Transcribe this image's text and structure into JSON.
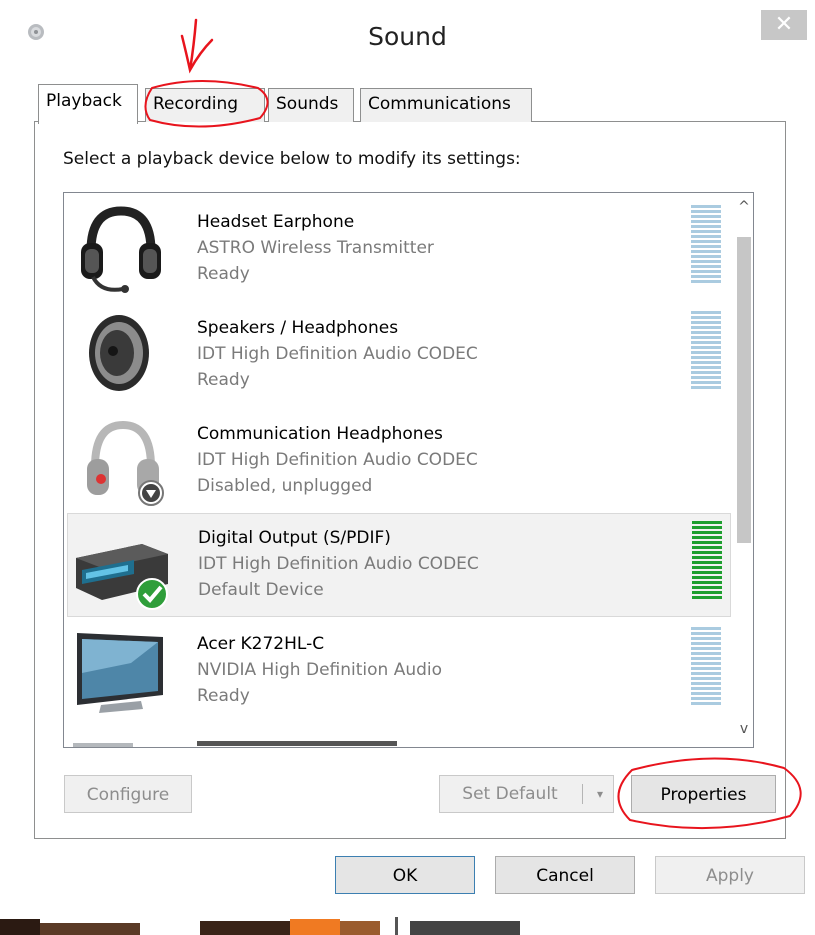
{
  "window": {
    "title": "Sound",
    "close_glyph": "✕",
    "app_icon": "speaker-app-icon"
  },
  "tabs": [
    {
      "label": "Playback",
      "active": true
    },
    {
      "label": "Recording",
      "active": false
    },
    {
      "label": "Sounds",
      "active": false
    },
    {
      "label": "Communications",
      "active": false
    }
  ],
  "instruction": "Select a playback device below to modify its settings:",
  "devices": [
    {
      "name": "Headset Earphone",
      "driver": "ASTRO Wireless Transmitter",
      "status": "Ready",
      "icon": "headset-icon",
      "level_color": "#aacbe0"
    },
    {
      "name": "Speakers / Headphones",
      "driver": "IDT High Definition Audio CODEC",
      "status": "Ready",
      "icon": "speaker-icon",
      "level_color": "#aacbe0"
    },
    {
      "name": "Communication Headphones",
      "driver": "IDT High Definition Audio CODEC",
      "status": "Disabled, unplugged",
      "icon": "headphones-icon",
      "level_color": "#aacbe0"
    },
    {
      "name": "Digital Output (S/PDIF)",
      "driver": "IDT High Definition Audio CODEC",
      "status": "Default Device",
      "icon": "digital-receiver-icon",
      "level_color": "#1e9e2f",
      "selected": true
    },
    {
      "name": "Acer K272HL-C",
      "driver": "NVIDIA High Definition Audio",
      "status": "Ready",
      "icon": "monitor-icon",
      "level_color": "#aacbe0"
    }
  ],
  "scrollbar": {
    "up_glyph": "^",
    "down_glyph": "v"
  },
  "buttons": {
    "configure": "Configure",
    "set_default": "Set Default",
    "set_default_arrow": "▾",
    "properties": "Properties",
    "ok": "OK",
    "cancel": "Cancel",
    "apply": "Apply"
  },
  "colors": {
    "annotation": "#e8141d",
    "selection": "#f2f2f2",
    "default_check": "#3aa83a"
  }
}
